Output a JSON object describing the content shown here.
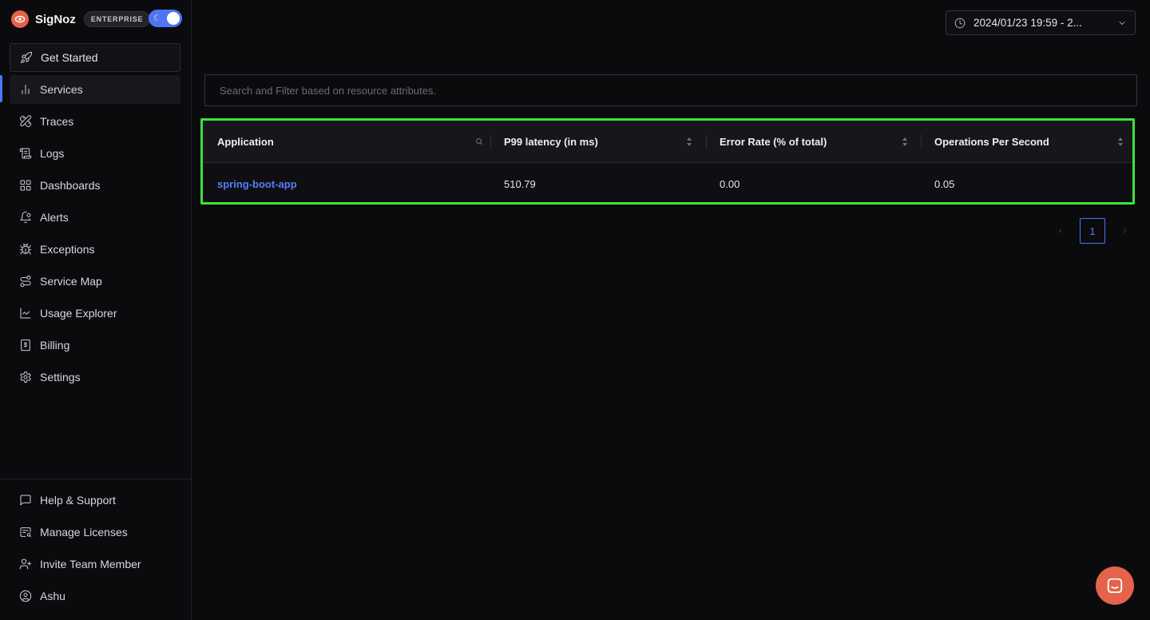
{
  "brand": {
    "name": "SigNoz",
    "badge": "ENTERPRISE"
  },
  "sidebar": {
    "get_started": "Get Started",
    "items": [
      {
        "label": "Services",
        "icon": "bar-chart-icon",
        "active": true
      },
      {
        "label": "Traces",
        "icon": "pencil-ruler-icon"
      },
      {
        "label": "Logs",
        "icon": "scroll-text-icon"
      },
      {
        "label": "Dashboards",
        "icon": "layout-grid-icon"
      },
      {
        "label": "Alerts",
        "icon": "bell-dot-icon"
      },
      {
        "label": "Exceptions",
        "icon": "bug-icon"
      },
      {
        "label": "Service Map",
        "icon": "route-icon"
      },
      {
        "label": "Usage Explorer",
        "icon": "line-chart-icon"
      },
      {
        "label": "Billing",
        "icon": "receipt-icon"
      },
      {
        "label": "Settings",
        "icon": "gear-icon"
      }
    ],
    "bottom_items": [
      {
        "label": "Help & Support",
        "icon": "message-square-icon"
      },
      {
        "label": "Manage Licenses",
        "icon": "shield-key-icon"
      },
      {
        "label": "Invite Team Member",
        "icon": "user-plus-icon"
      },
      {
        "label": "Ashu",
        "icon": "user-circle-icon"
      }
    ]
  },
  "topbar": {
    "time_range": "2024/01/23 19:59 - 2..."
  },
  "search": {
    "placeholder": "Search and Filter based on resource attributes."
  },
  "table": {
    "columns": [
      "Application",
      "P99 latency (in ms)",
      "Error Rate (% of total)",
      "Operations Per Second"
    ],
    "rows": [
      {
        "application": "spring-boot-app",
        "p99": "510.79",
        "error_rate": "0.00",
        "ops": "0.05"
      }
    ]
  },
  "pagination": {
    "current_page": "1"
  },
  "colors": {
    "accent": "#4e74f8",
    "brand": "#e5634a",
    "highlight": "#3ee23a",
    "link": "#5a7cf6"
  }
}
